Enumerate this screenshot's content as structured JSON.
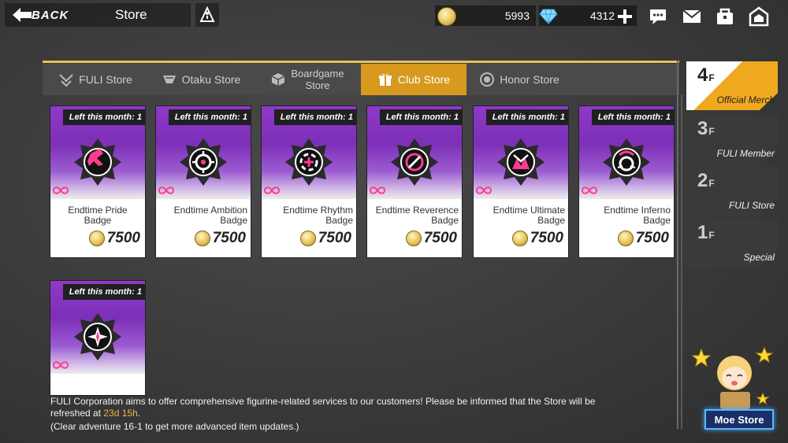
{
  "header": {
    "back_label": "BACK",
    "title": "Store",
    "coins": "5993",
    "crystals": "4312"
  },
  "tabs": [
    {
      "label": "FULI Store",
      "icon": "fuli-icon",
      "active": false
    },
    {
      "label": "Otaku Store",
      "icon": "otaku-icon",
      "active": false
    },
    {
      "label": "Boardgame Store",
      "line1": "Boardgame",
      "line2": "Store",
      "icon": "boardgame-icon",
      "active": false
    },
    {
      "label": "Club Store",
      "icon": "gift-icon",
      "active": true
    },
    {
      "label": "Honor Store",
      "icon": "honor-icon",
      "active": false
    }
  ],
  "items": [
    {
      "stock": "Left this month: 1",
      "name": "Endtime Pride Badge",
      "price": "7500"
    },
    {
      "stock": "Left this month: 1",
      "name": "Endtime Ambition Badge",
      "price": "7500"
    },
    {
      "stock": "Left this month: 1",
      "name": "Endtime Rhythm Badge",
      "price": "7500"
    },
    {
      "stock": "Left this month: 1",
      "name": "Endtime Reverence Badge",
      "price": "7500"
    },
    {
      "stock": "Left this month: 1",
      "name": "Endtime Ultimate Badge",
      "price": "7500"
    },
    {
      "stock": "Left this month: 1",
      "name": "Endtime Inferno Badge",
      "price": "7500"
    },
    {
      "stock": "Left this month: 1",
      "name": "",
      "price": ""
    }
  ],
  "floors": [
    {
      "num": "4",
      "suffix": "F",
      "label": "Official Merch",
      "active": true
    },
    {
      "num": "3",
      "suffix": "F",
      "label": "FULI Member",
      "active": false
    },
    {
      "num": "2",
      "suffix": "F",
      "label": "FULI Store",
      "active": false
    },
    {
      "num": "1",
      "suffix": "F",
      "label": "Special",
      "active": false
    }
  ],
  "notice": {
    "text1": "FULI Corporation aims to offer comprehensive figurine-related services to our customers! Please be informed that the Store will be refreshed at ",
    "refresh": "23d 15h",
    "text2": ".",
    "text3": "(Clear adventure ",
    "stage": "16-1",
    "text4": " to get more advanced item updates.)"
  },
  "moe_store": {
    "label": "Moe Store"
  },
  "colors": {
    "accent": "#d79a1e",
    "card_purple": "#8f39c8",
    "highlight": "#f0b74a"
  }
}
